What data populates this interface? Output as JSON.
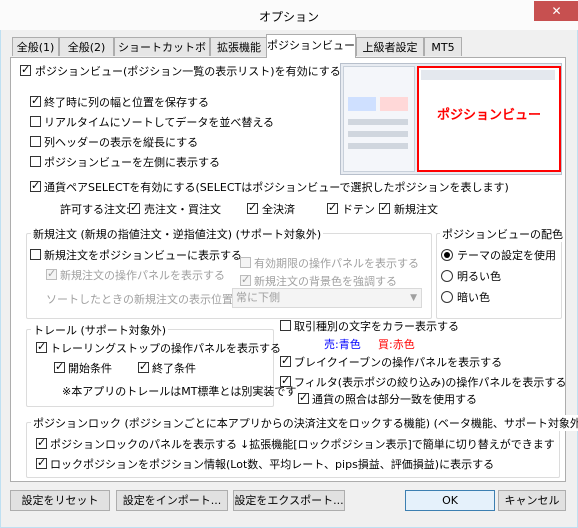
{
  "window": {
    "title": "オプション",
    "close_glyph": "✕"
  },
  "tabs": [
    "全般(1)",
    "全般(2)",
    "ショートカットボタン",
    "拡張機能",
    "ポジションビュー",
    "上級者設定",
    "MT5"
  ],
  "options": {
    "enable_position_view": "ポジションビュー(ポジション一覧の表示リスト)を有効にする",
    "save_columns": "終了時に列の幅と位置を保存する",
    "realtime_sort": "リアルタイムにソートしてデータを並べ替える",
    "vertical_header": "列ヘッダーの表示を縦長にする",
    "left_side": "ポジションビューを左側に表示する",
    "pair_select": "通貨ペアSELECTを有効にする(SELECTはポジションビューで選択したポジションを表します)",
    "allowed_orders_label": "許可する注文:",
    "allowed_orders": [
      "売注文・買注文",
      "全決済",
      "ドテン",
      "新規注文"
    ]
  },
  "preview": {
    "label": "ポジションビュー"
  },
  "new_order_group": {
    "title": "新規注文 (新規の指値注文・逆指値注文) (サポート対象外)",
    "show_in_view": "新規注文をポジションビューに表示する",
    "show_panel": "新規注文の操作パネルを表示する",
    "show_expiry_panel": "有効期限の操作パネルを表示する",
    "highlight_bg": "新規注文の背景色を強調する",
    "sort_label": "ソートしたときの新規注文の表示位置:",
    "sort_value": "常に下側"
  },
  "color_group": {
    "title": "ポジションビューの配色",
    "options": [
      "テーマの設定を使用",
      "明るい色",
      "暗い色"
    ]
  },
  "trail_group": {
    "title": "トレール (サポート対象外)",
    "show_panel": "トレーリングストップの操作パネルを表示する",
    "start_cond": "開始条件",
    "end_cond": "終了条件",
    "note": "※本アプリのトレールはMT標準とは別実装です"
  },
  "right_options": {
    "color_type": "取引種別の文字をカラー表示する",
    "sell_label": "売:青色",
    "buy_label": "買:赤色",
    "breakeven_panel": "ブレイクイーブンの操作パネルを表示する",
    "filter_panel": "フィルタ(表示ポジの絞り込み)の操作パネルを表示する",
    "partial_match": "通貨の照合は部分一致を使用する"
  },
  "lock_group": {
    "title": "ポジションロック (ポジションごとに本アプリからの決済注文をロックする機能) (ベータ機能、サポート対象外)",
    "show_panel": "ポジションロックのパネルを表示する",
    "hint": "↓拡張機能[ロックポジション表示]で簡単に切り替えができます",
    "show_info": "ロックポジションをポジション情報(Lot数、平均レート、pips損益、評価損益)に表示する"
  },
  "footer": {
    "reset": "設定をリセット",
    "import": "設定をインポート...",
    "export": "設定をエクスポート...",
    "ok": "OK",
    "cancel": "キャンセル"
  },
  "colors": {
    "sell": "#0000ff",
    "buy": "#ff0000",
    "preview_border": "#ff0000",
    "preview_text": "#ff0000"
  }
}
